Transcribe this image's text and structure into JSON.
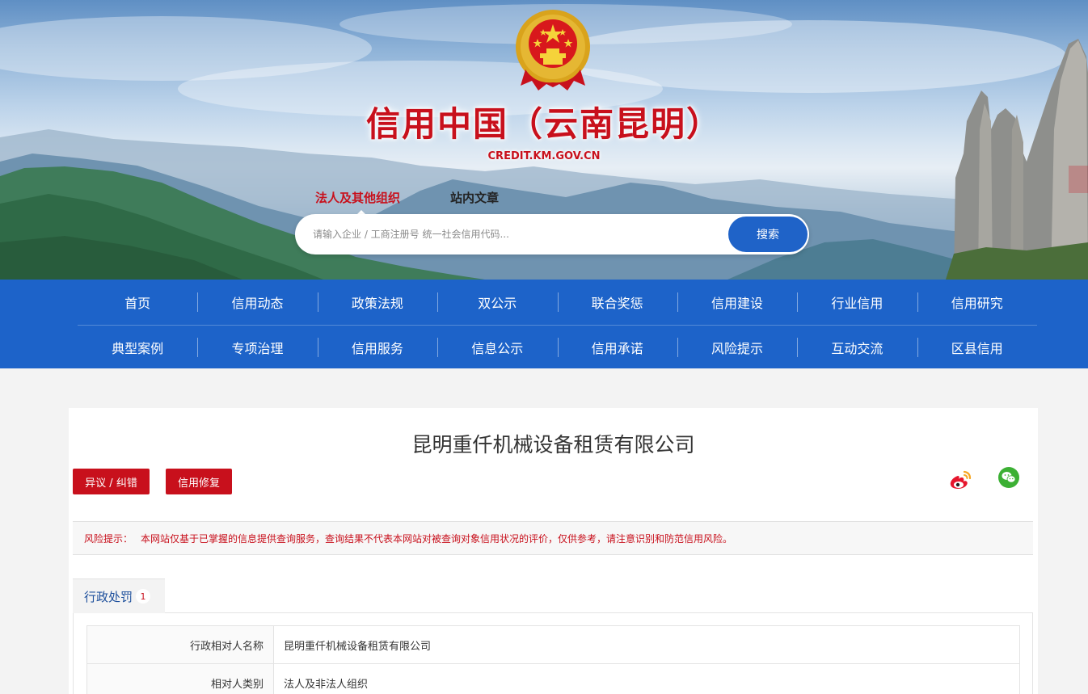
{
  "header": {
    "title": "信用中国（云南昆明）",
    "url": "CREDIT.KM.GOV.CN",
    "emblem_icon": "national-emblem"
  },
  "search": {
    "tabs": [
      "法人及其他组织",
      "站内文章"
    ],
    "active_tab": 0,
    "placeholder": "请输入企业 / 工商注册号 统一社会信用代码...",
    "button_label": "搜索"
  },
  "nav": {
    "row1": [
      "首页",
      "信用动态",
      "政策法规",
      "双公示",
      "联合奖惩",
      "信用建设",
      "行业信用",
      "信用研究"
    ],
    "row2": [
      "典型案例",
      "专项治理",
      "信用服务",
      "信息公示",
      "信用承诺",
      "风险提示",
      "互动交流",
      "区县信用"
    ]
  },
  "company": {
    "name": "昆明重仟机械设备租赁有限公司",
    "objection_button": "异议 / 纠错",
    "repair_button": "信用修复",
    "share_icons": [
      "weibo-icon",
      "wechat-icon"
    ]
  },
  "risk": {
    "label": "风险提示：",
    "text": "本网站仅基于已掌握的信息提供查询服务，查询结果不代表本网站对被查询对象信用状况的评价，仅供参考，请注意识别和防范信用风险。"
  },
  "tabs": [
    {
      "label": "行政处罚",
      "count": "1"
    }
  ],
  "details": [
    {
      "key": "行政相对人名称",
      "value": "昆明重仟机械设备租赁有限公司"
    },
    {
      "key": "相对人类别",
      "value": "法人及非法人组织"
    }
  ],
  "colors": {
    "brand_red": "#c8101c",
    "nav_blue": "#1d63c9",
    "button_blue": "#1f63c8"
  }
}
